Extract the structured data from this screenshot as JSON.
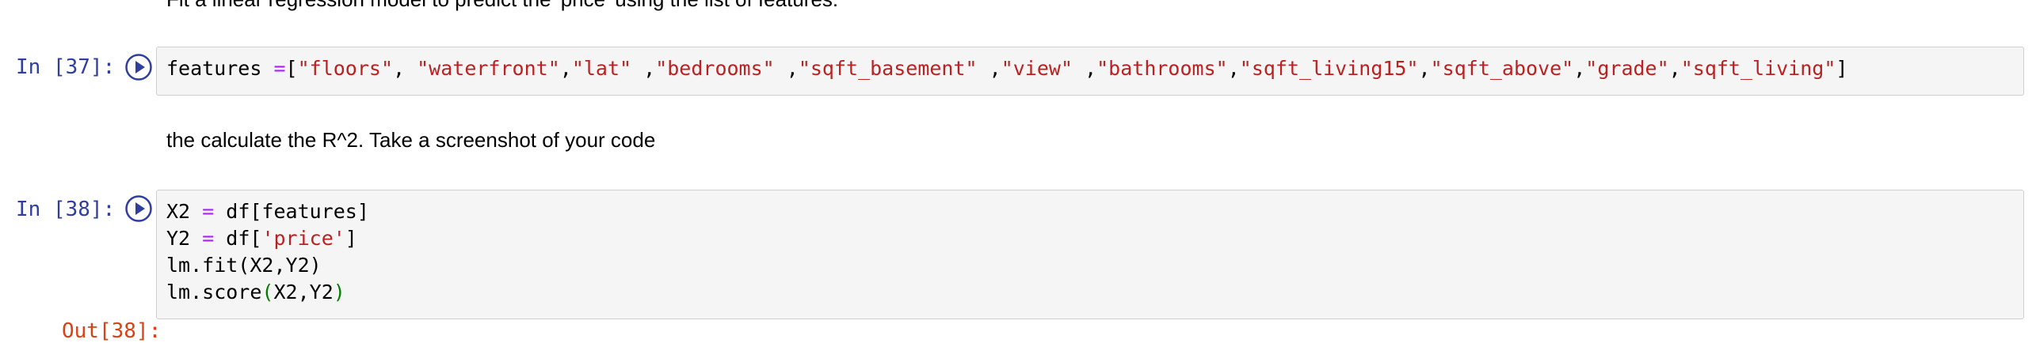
{
  "notebook": {
    "top_markdown_text": "Fit a linear regression model to predict the 'price' using the list of features:",
    "cell_37": {
      "prompt": "In [37]:",
      "code": {
        "t1": "features ",
        "t2": "=",
        "t3": "[",
        "t4": "\"floors\"",
        "t5": ", ",
        "t6": "\"waterfront\"",
        "t7": ",",
        "t8": "\"lat\"",
        "t9": " ,",
        "t10": "\"bedrooms\"",
        "t11": " ,",
        "t12": "\"sqft_basement\"",
        "t13": " ,",
        "t14": "\"view\"",
        "t15": " ,",
        "t16": "\"bathrooms\"",
        "t17": ",",
        "t18": "\"sqft_living15\"",
        "t19": ",",
        "t20": "\"sqft_above\"",
        "t21": ",",
        "t22": "\"grade\"",
        "t23": ",",
        "t24": "\"sqft_living\"",
        "t25": "]"
      }
    },
    "markdown_2_text": "the calculate the R^2. Take a screenshot of your code",
    "cell_38": {
      "prompt": "In [38]:",
      "line1": {
        "a": "X2 ",
        "b": "=",
        "c": " df[features]"
      },
      "line2": {
        "a": "Y2 ",
        "b": "=",
        "c": " df[",
        "d": "'price'",
        "e": "]"
      },
      "line3": {
        "a": "lm.fit(X2,Y2)"
      },
      "line4": {
        "a": "lm.score",
        "b": "(",
        "c": "X2,Y2",
        "d": ")"
      }
    },
    "bottom_prompt_partial": "Out[38]:"
  },
  "colors": {
    "prompt_in": "#303f9f",
    "prompt_out": "#d84315",
    "string": "#ba2121",
    "operator": "#aa22ff",
    "paren": "#008000",
    "cell_bg": "#f5f5f5",
    "cell_border": "#cfcfcf"
  },
  "icons": {
    "run_button": "play-circle-icon"
  }
}
